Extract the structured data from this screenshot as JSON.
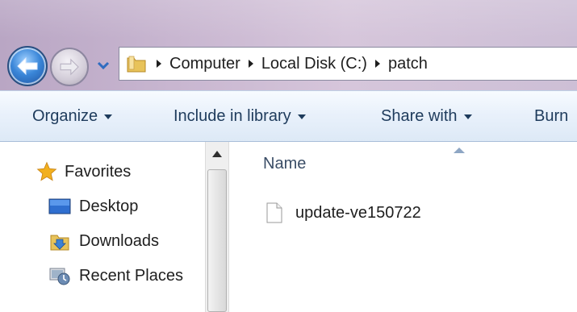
{
  "address": {
    "breadcrumbs": [
      "Computer",
      "Local Disk (C:)",
      "patch"
    ]
  },
  "toolbar": {
    "organize": "Organize",
    "include_in_library": "Include in library",
    "share_with": "Share with",
    "burn": "Burn"
  },
  "nav": {
    "items": [
      {
        "label": "Favorites",
        "icon": "star-icon"
      },
      {
        "label": "Desktop",
        "icon": "desktop-icon"
      },
      {
        "label": "Downloads",
        "icon": "downloads-folder-icon"
      },
      {
        "label": "Recent Places",
        "icon": "recent-places-icon"
      }
    ]
  },
  "filelist": {
    "column_name": "Name",
    "files": [
      {
        "name": "update-ve150722",
        "icon": "file-icon"
      }
    ]
  },
  "colors": {
    "title_gradient": "#c8b6d0",
    "back_button": "#3a86d8",
    "command_bar_text": "#1e3b5c",
    "star": "#f2b01e",
    "folder": "#e8c35a"
  }
}
